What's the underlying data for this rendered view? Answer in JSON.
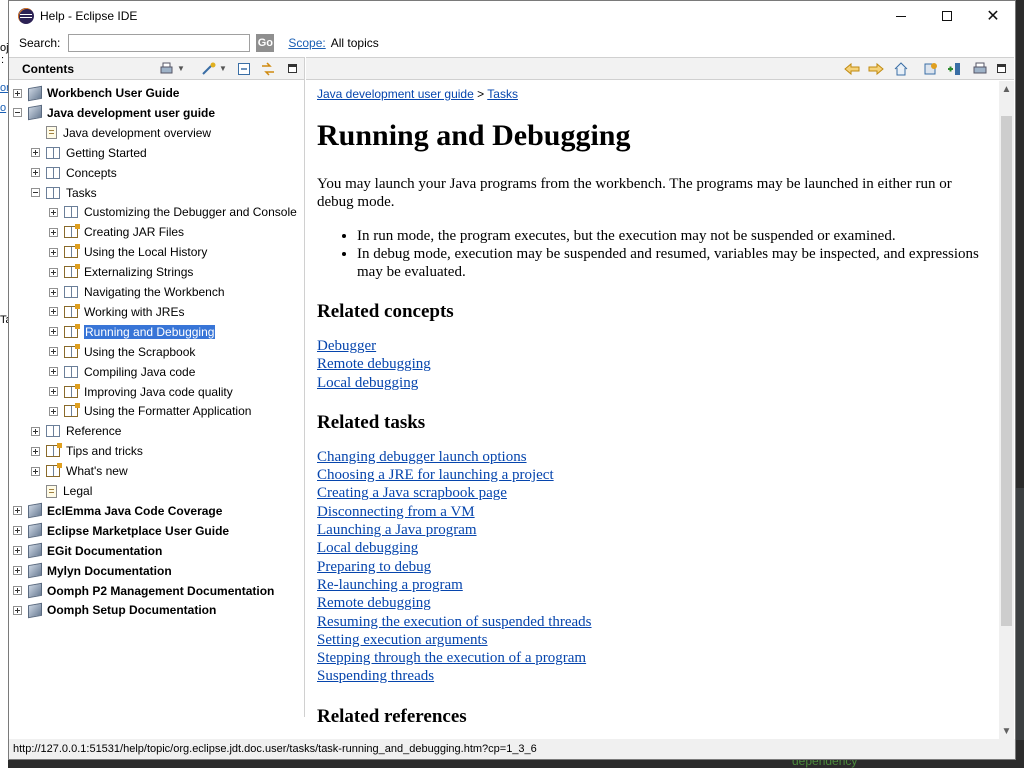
{
  "background": {
    "left_fragments": [
      "oj",
      ":",
      "or",
      "o",
      "Ta"
    ],
    "bottom_text": "dependency"
  },
  "window": {
    "title": "Help - Eclipse IDE",
    "minimize_glyph": "",
    "close_glyph": "✕"
  },
  "search": {
    "label": "Search:",
    "value": "",
    "go_label": "Go",
    "scope_link": "Scope:",
    "scope_value": "All topics"
  },
  "contents": {
    "title": "Contents",
    "tree": [
      {
        "label": "Workbench User Guide",
        "level": 0,
        "expander": "plus",
        "icon": "book-cube-icon",
        "bold": true
      },
      {
        "label": "Java development user guide",
        "level": 0,
        "expander": "minus",
        "icon": "book-cube-icon",
        "bold": true
      },
      {
        "label": "Java development overview",
        "level": 1,
        "expander": "none",
        "icon": "page-icon"
      },
      {
        "label": "Getting Started",
        "level": 1,
        "expander": "plus",
        "icon": "book-icon"
      },
      {
        "label": "Concepts",
        "level": 1,
        "expander": "plus",
        "icon": "book-icon"
      },
      {
        "label": "Tasks",
        "level": 1,
        "expander": "minus",
        "icon": "book-icon"
      },
      {
        "label": "Customizing the Debugger and Console",
        "level": 2,
        "expander": "plus",
        "icon": "book-icon"
      },
      {
        "label": "Creating JAR Files",
        "level": 2,
        "expander": "plus",
        "icon": "task-book-icon"
      },
      {
        "label": "Using the Local History",
        "level": 2,
        "expander": "plus",
        "icon": "task-book-icon"
      },
      {
        "label": "Externalizing Strings",
        "level": 2,
        "expander": "plus",
        "icon": "task-book-icon"
      },
      {
        "label": "Navigating the Workbench",
        "level": 2,
        "expander": "plus",
        "icon": "book-icon"
      },
      {
        "label": "Working with JREs",
        "level": 2,
        "expander": "plus",
        "icon": "task-book-icon"
      },
      {
        "label": "Running and Debugging",
        "level": 2,
        "expander": "plus",
        "icon": "task-book-icon",
        "selected": true
      },
      {
        "label": "Using the Scrapbook",
        "level": 2,
        "expander": "plus",
        "icon": "task-book-icon"
      },
      {
        "label": "Compiling Java code",
        "level": 2,
        "expander": "plus",
        "icon": "book-icon"
      },
      {
        "label": "Improving Java code quality",
        "level": 2,
        "expander": "plus",
        "icon": "task-book-icon"
      },
      {
        "label": "Using the Formatter Application",
        "level": 2,
        "expander": "plus",
        "icon": "task-book-icon"
      },
      {
        "label": "Reference",
        "level": 1,
        "expander": "plus",
        "icon": "book-icon"
      },
      {
        "label": "Tips and tricks",
        "level": 1,
        "expander": "plus",
        "icon": "task-book-icon"
      },
      {
        "label": "What's new",
        "level": 1,
        "expander": "plus",
        "icon": "task-book-icon"
      },
      {
        "label": "Legal",
        "level": 1,
        "expander": "none",
        "icon": "page-icon"
      },
      {
        "label": "EclEmma Java Code Coverage",
        "level": 0,
        "expander": "plus",
        "icon": "book-cube-icon",
        "bold": true
      },
      {
        "label": "Eclipse Marketplace User Guide",
        "level": 0,
        "expander": "plus",
        "icon": "book-cube-icon",
        "bold": true
      },
      {
        "label": "EGit Documentation",
        "level": 0,
        "expander": "plus",
        "icon": "book-cube-icon",
        "bold": true
      },
      {
        "label": "Mylyn Documentation",
        "level": 0,
        "expander": "plus",
        "icon": "book-cube-icon",
        "bold": true
      },
      {
        "label": "Oomph P2 Management Documentation",
        "level": 0,
        "expander": "plus",
        "icon": "book-cube-icon",
        "bold": true
      },
      {
        "label": "Oomph Setup Documentation",
        "level": 0,
        "expander": "plus",
        "icon": "book-cube-icon",
        "bold": true
      }
    ]
  },
  "bottom_tabs": [
    "contents-tab-icon",
    "index-tab-icon",
    "search-results-tab-icon",
    "bookmarks-tab-icon"
  ],
  "content": {
    "breadcrumb": [
      "Java development user guide",
      "Tasks"
    ],
    "breadcrumb_sep": ">",
    "title": "Running and Debugging",
    "intro": "You may launch your Java programs from the workbench.  The programs may be launched in either run or debug mode.",
    "bullets": [
      "In run mode, the program executes, but the execution may not be suspended or examined.",
      "In debug mode, execution may be suspended and resumed, variables may be inspected, and expressions may be evaluated."
    ],
    "sections": [
      {
        "heading": "Related concepts",
        "links": [
          "Debugger",
          "Remote debugging",
          "Local debugging"
        ]
      },
      {
        "heading": "Related tasks",
        "links": [
          "Changing debugger launch options",
          "Choosing a JRE for launching a project",
          "Creating a Java scrapbook page",
          "Disconnecting from a VM",
          "Launching a Java program",
          "Local debugging",
          "Preparing to debug",
          "Re-launching a program",
          "Remote debugging",
          "Resuming the execution of suspended threads",
          "Setting execution arguments",
          "Stepping through the execution of a program",
          "Suspending threads"
        ]
      },
      {
        "heading": "Related references",
        "links": []
      }
    ]
  },
  "status": {
    "url": "http://127.0.0.1:51531/help/topic/org.eclipse.jdt.doc.user/tasks/task-running_and_debugging.htm?cp=1_3_6"
  }
}
